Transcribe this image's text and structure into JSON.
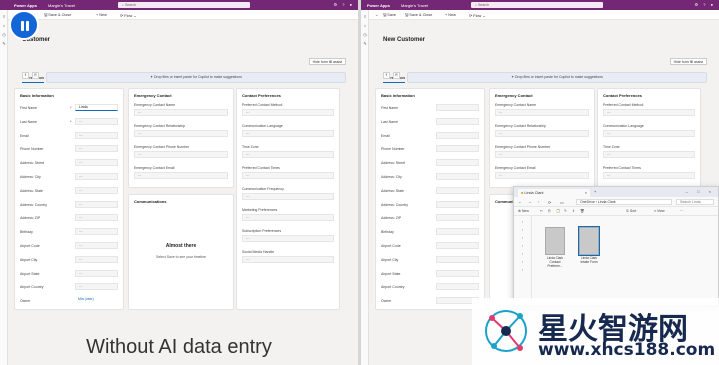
{
  "left": {
    "topbar": {
      "app": "Power Apps",
      "crumb": "Margie's Travel",
      "search": "Search"
    },
    "cmd": [
      "Save",
      "Save & Close",
      "New",
      "Flow"
    ],
    "title": "Customer",
    "hide_form": "Hide form fill assist",
    "tabs": [
      "Information",
      "Preferences"
    ],
    "drop_text": "Drop files or insert paste for Copilot to make suggestions",
    "basic": {
      "title": "Basic Information",
      "rows": [
        {
          "label": "First Name",
          "value": "Linda"
        },
        {
          "label": "Last Name",
          "value": "---"
        },
        {
          "label": "Email",
          "value": "---"
        },
        {
          "label": "Phone Number",
          "value": "---"
        },
        {
          "label": "Address: Street",
          "value": "---"
        },
        {
          "label": "Address: City",
          "value": "---"
        },
        {
          "label": "Address: State",
          "value": "---"
        },
        {
          "label": "Address: Country",
          "value": "---"
        },
        {
          "label": "Address: ZIP",
          "value": "---"
        },
        {
          "label": "Birthday",
          "value": "---"
        },
        {
          "label": "Airport Code",
          "value": "---"
        },
        {
          "label": "Airport City",
          "value": "---"
        },
        {
          "label": "Airport State",
          "value": "---"
        },
        {
          "label": "Airport Country",
          "value": "---"
        },
        {
          "label": "Owner",
          "value": "Mia (user)"
        }
      ]
    },
    "emergency": {
      "title": "Emergency Contact",
      "fields": [
        {
          "label": "Emergency Contact Name",
          "value": "---"
        },
        {
          "label": "Emergency Contact Relationship",
          "value": "---"
        },
        {
          "label": "Emergency Contact Phone Number",
          "value": "---"
        },
        {
          "label": "Emergency Contact Email",
          "value": "---"
        }
      ]
    },
    "comms": {
      "title": "Communications",
      "heading": "Almost there",
      "sub": "Select Save to see your timeline"
    },
    "prefs": {
      "title": "Contact Preferences",
      "fields": [
        {
          "label": "Preferred Contact Method",
          "value": "---"
        },
        {
          "label": "Communication Language",
          "value": "---"
        },
        {
          "label": "Time Zone",
          "value": "---"
        },
        {
          "label": "Preferred Contact Times",
          "value": "---"
        },
        {
          "label": "Communication Frequency",
          "value": "---"
        },
        {
          "label": "Marketing Preferences",
          "value": "---"
        },
        {
          "label": "Subscription Preferences",
          "value": "---"
        },
        {
          "label": "Social Media Handle",
          "value": "---"
        }
      ]
    },
    "caption": "Without AI data entry"
  },
  "right": {
    "title": "New Customer",
    "rows": [
      "First Name",
      "Last Name",
      "Email",
      "Phone Number",
      "Address: Street",
      "Address: City",
      "Address: State",
      "Address: Country",
      "Address: ZIP",
      "Birthday",
      "Airport Code",
      "Airport City",
      "Airport State",
      "Airport Country",
      "Owner"
    ],
    "caption": "Wi"
  },
  "explorer": {
    "tab": "Linda Clark",
    "path_root": "OneDrive",
    "path_folder": "Linda Clark",
    "search": "Search Linda",
    "tools": [
      "New",
      "Sort",
      "View"
    ],
    "files": [
      "Linda Clark Contact Preferen...",
      "Linda Clark Intake Form"
    ]
  },
  "watermark": {
    "cn": "星火智游网",
    "url": "www.xhcs188.com"
  }
}
